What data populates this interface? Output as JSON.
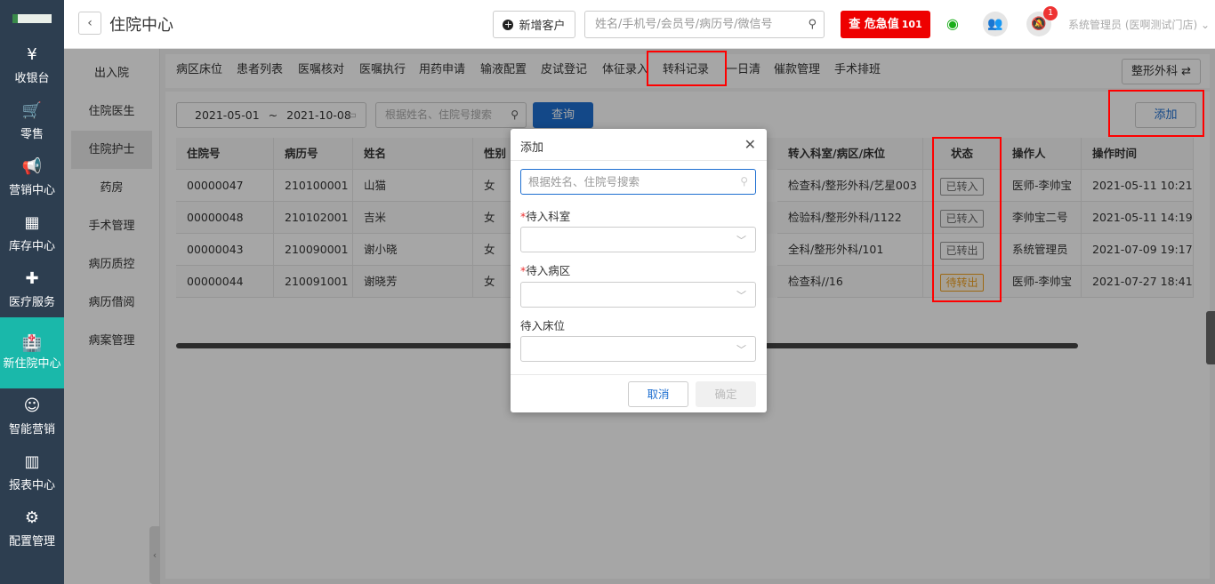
{
  "leftnav": {
    "items": [
      {
        "icon": "yen-icon",
        "glyph": "¥",
        "label": "收银台"
      },
      {
        "icon": "cart-icon",
        "glyph": "🛒",
        "label": "零售"
      },
      {
        "icon": "megaphone-icon",
        "glyph": "📢",
        "label": "营销中心"
      },
      {
        "icon": "grid-icon",
        "glyph": "▦",
        "label": "库存中心"
      },
      {
        "icon": "medkit-icon",
        "glyph": "✚",
        "label": "医疗服务"
      },
      {
        "icon": "hospital-icon",
        "glyph": "🏥",
        "label": "新住院中心"
      },
      {
        "icon": "smart-marketing-icon",
        "glyph": "☺",
        "label": "智能营销"
      },
      {
        "icon": "bar-chart-icon",
        "glyph": "▥",
        "label": "报表中心"
      },
      {
        "icon": "gear-icon",
        "glyph": "⚙",
        "label": "配置管理"
      }
    ],
    "active_index": 5
  },
  "header": {
    "back_glyph": "‹",
    "title": "住院中心",
    "new_customer": "新增客户",
    "search_placeholder": "姓名/手机号/会员号/病历号/微信号",
    "critical_label": "查 危急值",
    "critical_count": "101",
    "bell_badge": "1",
    "user": "系统管理员 (医啊测试门店)"
  },
  "subnav": {
    "items": [
      "出入院",
      "住院医生",
      "住院护士",
      "药房",
      "手术管理",
      "病历质控",
      "病历借阅",
      "病案管理"
    ],
    "active_index": 2
  },
  "tabs": {
    "items": [
      "病区床位",
      "患者列表",
      "医嘱核对",
      "医嘱执行",
      "用药申请",
      "输液配置",
      "皮试登记",
      "体征录入",
      "转科记录",
      "一日清",
      "催款管理",
      "手术排班"
    ],
    "active_index": 8,
    "dept_button": "整形外科 ⇄"
  },
  "filter": {
    "date_start": "2021-05-01",
    "date_sep": "~",
    "date_end": "2021-10-08",
    "search_placeholder": "根据姓名、住院号搜索",
    "query_button": "查询",
    "add_button": "添加"
  },
  "table": {
    "headers": [
      "住院号",
      "病历号",
      "姓名",
      "性别",
      "转入科室/病区/床位",
      "状态",
      "操作人",
      "操作时间"
    ],
    "rows": [
      {
        "admission_no": "00000047",
        "record_no": "210100001",
        "name": "山猫",
        "gender": "女",
        "to_dept": "检查科/整形外科/艺星003",
        "status": "已转入",
        "status_type": "normal",
        "operator": "医师-李帅宝",
        "time": "2021-05-11 10:21"
      },
      {
        "admission_no": "00000048",
        "record_no": "210102001",
        "name": "吉米",
        "gender": "女",
        "to_dept": "检验科/整形外科/1122",
        "status": "已转入",
        "status_type": "normal",
        "operator": "李帅宝二号",
        "time": "2021-05-11 14:19"
      },
      {
        "admission_no": "00000043",
        "record_no": "210090001",
        "name": "谢小晓",
        "gender": "女",
        "to_dept": "全科/整形外科/101",
        "status": "已转出",
        "status_type": "normal",
        "operator": "系统管理员",
        "time": "2021-07-09 19:17"
      },
      {
        "admission_no": "00000044",
        "record_no": "210091001",
        "name": "谢晓芳",
        "gender": "女",
        "to_dept": "检查科//16",
        "status": "待转出",
        "status_type": "warn",
        "operator": "医师-李帅宝",
        "time": "2021-07-27 18:41"
      }
    ]
  },
  "modal": {
    "title": "添加",
    "close_glyph": "✕",
    "search_placeholder": "根据姓名、住院号搜索",
    "dept_label": "待入科室",
    "ward_label": "待入病区",
    "bed_label": "待入床位",
    "required_mark": "*",
    "cancel": "取消",
    "confirm": "确定"
  },
  "colors": {
    "nav_bg": "#2d3e50",
    "nav_active": "#1ab8aa",
    "primary": "#1e6fd1",
    "critical": "#ee0000",
    "annotation": "#ff0000"
  }
}
